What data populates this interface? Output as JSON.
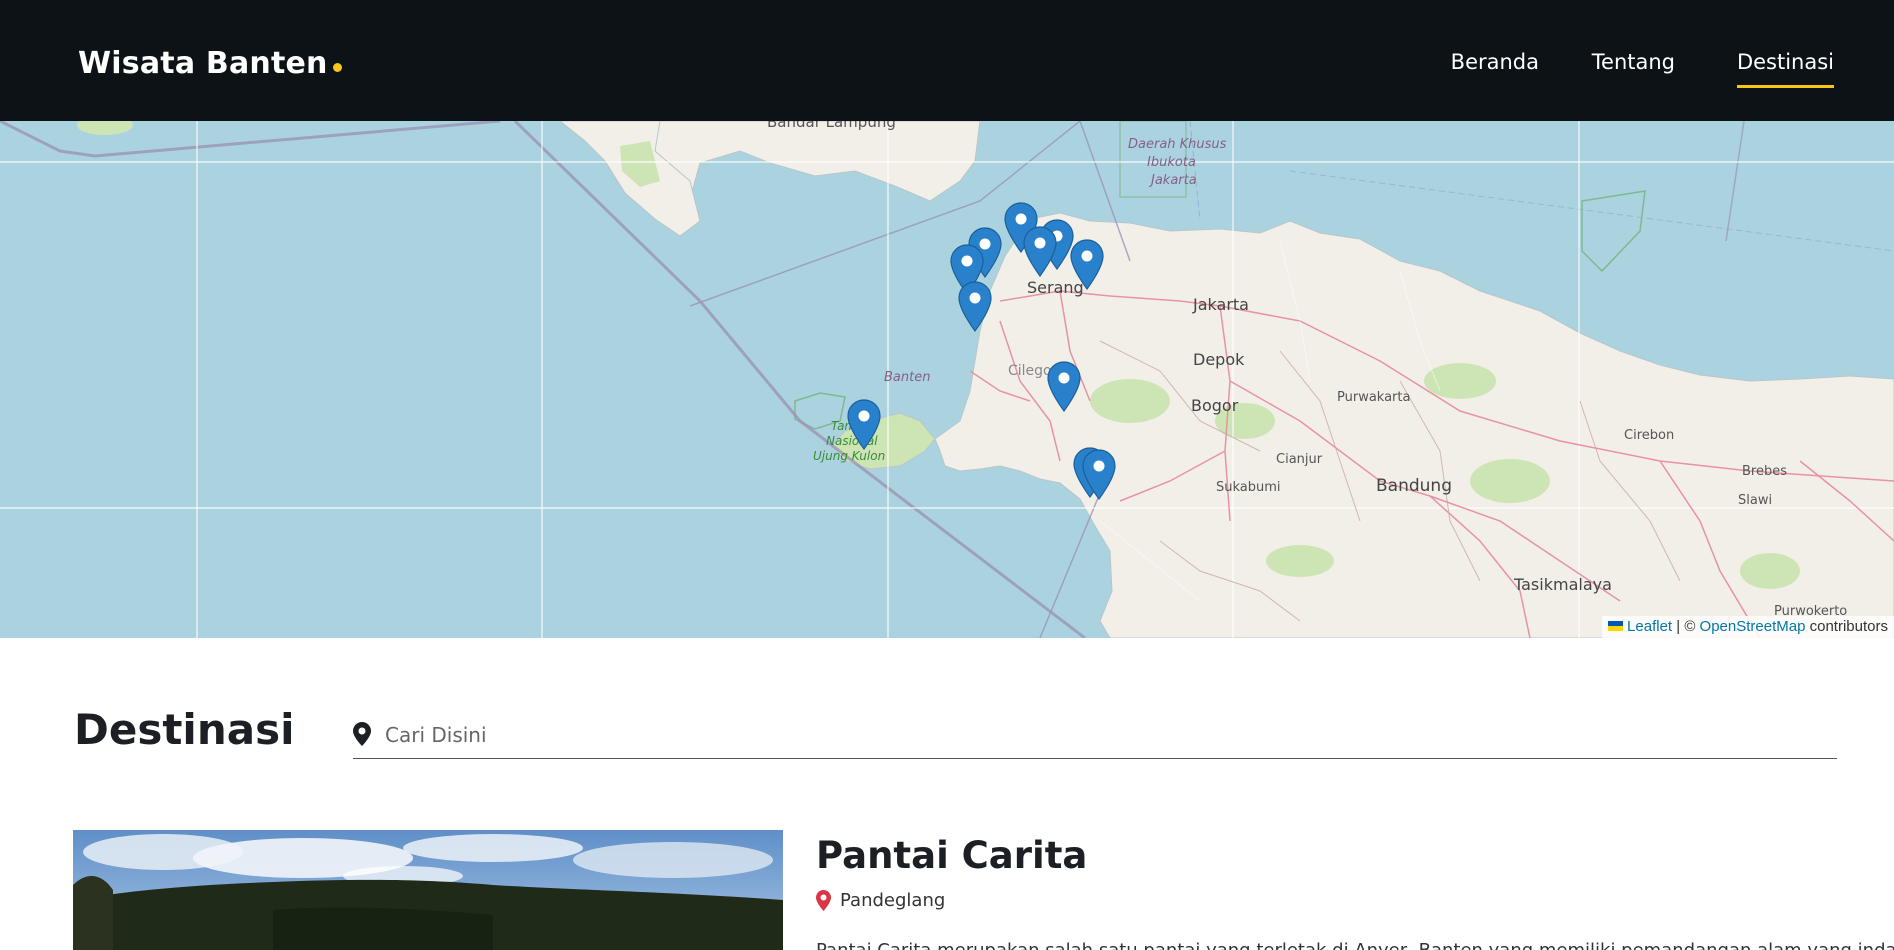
{
  "navbar": {
    "brand": "Wisata Banten",
    "links": [
      {
        "label": "Beranda",
        "active": false
      },
      {
        "label": "Tentang",
        "active": false
      },
      {
        "label": "Destinasi",
        "active": true
      }
    ],
    "accent_color": "#f5c518",
    "background_color": "#0c1216"
  },
  "map": {
    "place_labels": {
      "bandar_lampung": "Bandar Lampung",
      "dki_1": "Daerah Khusus",
      "dki_2": "Ibukota",
      "dki_3": "Jakarta",
      "cilegon": "Cilegon",
      "serang": "Serang",
      "jakarta": "Jakarta",
      "depok": "Depok",
      "bogor": "Bogor",
      "banten": "Banten",
      "purwakarta": "Purwakarta",
      "cirebon": "Cirebon",
      "brebes": "Brebes",
      "slawi": "Slawi",
      "cianjur": "Cianjur",
      "sukabumi": "Sukabumi",
      "bandung": "Bandung",
      "tasikmalaya": "Tasikmalaya",
      "purwokerto": "Purwokerto",
      "ujung_kulon_1": "Taman",
      "ujung_kulon_2": "Nasional",
      "ujung_kulon_3": "Ujung Kulon"
    },
    "marker_icon": "map-marker-icon",
    "marker_color": "#2a81cb",
    "attribution": {
      "leaflet": "Leaflet",
      "separator": " | © ",
      "osm": "OpenStreetMap",
      "contributors": " contributors"
    }
  },
  "section": {
    "title": "Destinasi",
    "search_placeholder": "Cari Disini",
    "search_icon": "map-pin-icon"
  },
  "destinations": [
    {
      "name": "Pantai Carita",
      "location": "Pandeglang",
      "location_icon": "map-pin-icon",
      "location_icon_color": "#dc3545",
      "description": "Pantai Carita merupakan salah satu pantai yang terletak di Anyer, Banten yang memiliki pemandangan alam yang indah"
    }
  ]
}
